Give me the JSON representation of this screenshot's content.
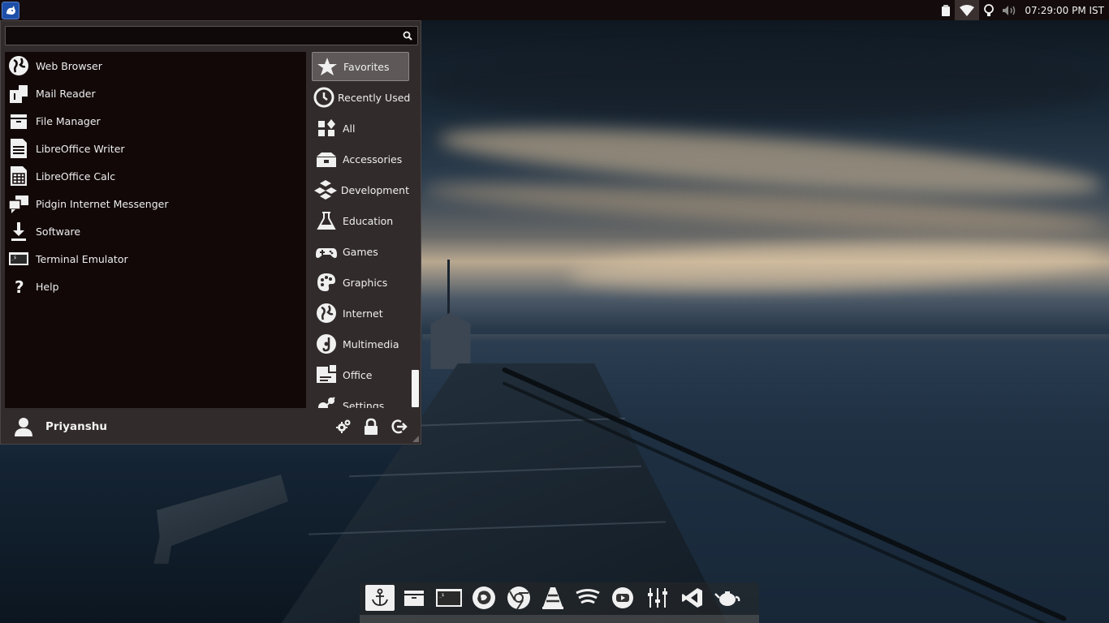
{
  "panel": {
    "clock": "07:29:00 PM IST"
  },
  "menu": {
    "search": {
      "value": "",
      "placeholder": ""
    },
    "favorites": [
      {
        "label": "Web Browser",
        "icon": "globe-icon"
      },
      {
        "label": "Mail Reader",
        "icon": "mailbox-icon"
      },
      {
        "label": "File Manager",
        "icon": "folder-icon"
      },
      {
        "label": "LibreOffice Writer",
        "icon": "writer-document-icon"
      },
      {
        "label": "LibreOffice Calc",
        "icon": "spreadsheet-icon"
      },
      {
        "label": "Pidgin Internet Messenger",
        "icon": "chat-bubbles-icon"
      },
      {
        "label": "Software",
        "icon": "download-icon"
      },
      {
        "label": "Terminal Emulator",
        "icon": "terminal-icon"
      },
      {
        "label": "Help",
        "icon": "question-icon"
      }
    ],
    "categories": [
      {
        "label": "Favorites",
        "icon": "star-icon",
        "active": true
      },
      {
        "label": "Recently Used",
        "icon": "clock-icon"
      },
      {
        "label": "All",
        "icon": "grid-icon"
      },
      {
        "label": "Accessories",
        "icon": "toolbox-icon"
      },
      {
        "label": "Development",
        "icon": "cubes-icon"
      },
      {
        "label": "Education",
        "icon": "flask-icon"
      },
      {
        "label": "Games",
        "icon": "gamepad-icon"
      },
      {
        "label": "Graphics",
        "icon": "palette-icon"
      },
      {
        "label": "Internet",
        "icon": "globe-icon"
      },
      {
        "label": "Multimedia",
        "icon": "music-disc-icon"
      },
      {
        "label": "Office",
        "icon": "pie-chart-icon"
      },
      {
        "label": "Settings",
        "icon": "settings-gears-icon"
      }
    ],
    "user": {
      "name": "Priyanshu"
    }
  },
  "dock": {
    "items": [
      "anchor-icon",
      "files-icon",
      "terminal-icon",
      "firefox-icon",
      "chrome-icon",
      "vlc-icon",
      "spotify-icon",
      "youtube-icon",
      "mixer-icon",
      "vscode-icon",
      "teapot-icon"
    ]
  }
}
